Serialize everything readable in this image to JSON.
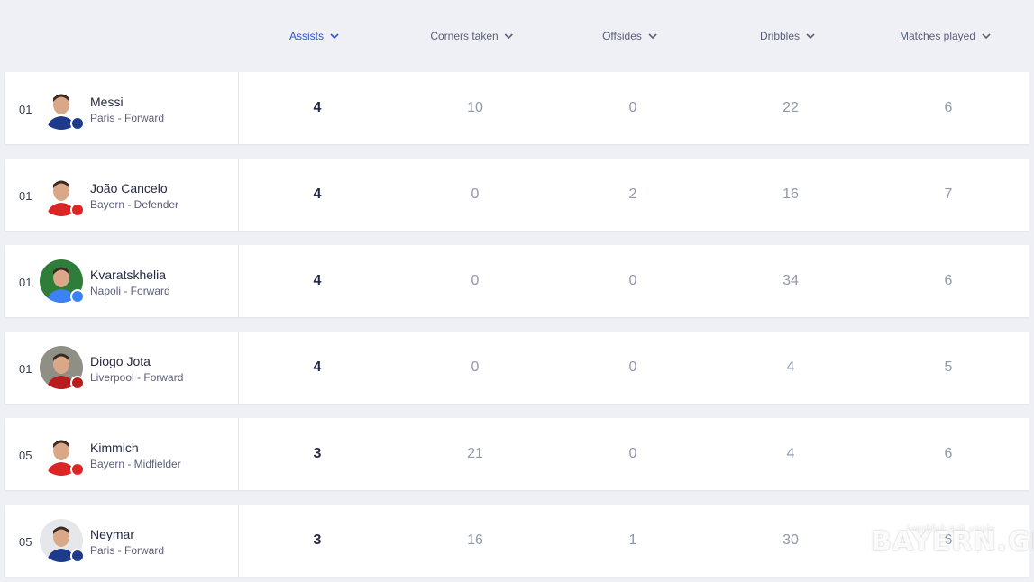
{
  "columns": [
    {
      "label": "Assists",
      "active": true
    },
    {
      "label": "Corners taken",
      "active": false
    },
    {
      "label": "Offsides",
      "active": false
    },
    {
      "label": "Dribbles",
      "active": false
    },
    {
      "label": "Matches played",
      "active": false
    }
  ],
  "players": [
    {
      "rank": "01",
      "name": "Messi",
      "meta": "Paris - Forward",
      "club_badge_color": "#1e3a8a",
      "avatar_bg": "#ffffff",
      "stats": [
        "4",
        "10",
        "0",
        "22",
        "6"
      ]
    },
    {
      "rank": "01",
      "name": "João Cancelo",
      "meta": "Bayern - Defender",
      "club_badge_color": "#dc2626",
      "avatar_bg": "#ffffff",
      "stats": [
        "4",
        "0",
        "2",
        "16",
        "7"
      ]
    },
    {
      "rank": "01",
      "name": "Kvaratskhelia",
      "meta": "Napoli - Forward",
      "club_badge_color": "#3b82f6",
      "avatar_bg": "#2f7d3a",
      "stats": [
        "4",
        "0",
        "0",
        "34",
        "6"
      ]
    },
    {
      "rank": "01",
      "name": "Diogo Jota",
      "meta": "Liverpool - Forward",
      "club_badge_color": "#b91c1c",
      "avatar_bg": "#8f8f86",
      "stats": [
        "4",
        "0",
        "0",
        "4",
        "5"
      ]
    },
    {
      "rank": "05",
      "name": "Kimmich",
      "meta": "Bayern - Midfielder",
      "club_badge_color": "#dc2626",
      "avatar_bg": "#ffffff",
      "stats": [
        "3",
        "21",
        "0",
        "4",
        "6"
      ]
    },
    {
      "rank": "05",
      "name": "Neymar",
      "meta": "Paris - Forward",
      "club_badge_color": "#1e3a8a",
      "avatar_bg": "#e5e7eb",
      "stats": [
        "3",
        "16",
        "1",
        "30",
        "6"
      ]
    }
  ],
  "watermark": {
    "main": "BAYERN.GE",
    "sub": "ბაიერნის ფან კლუბი"
  },
  "colors": {
    "accent": "#2f55d4",
    "bg": "#eef0f6",
    "text": "#262a44",
    "muted": "#9297aa"
  }
}
